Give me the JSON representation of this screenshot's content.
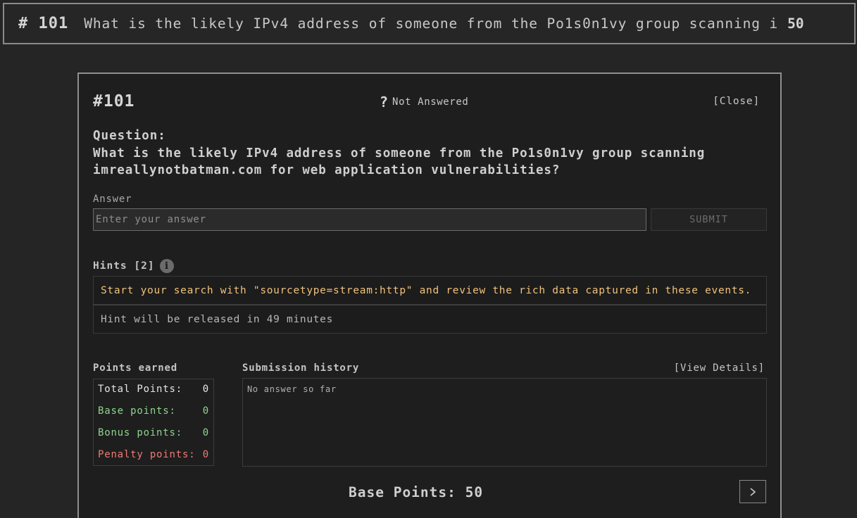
{
  "top_bar": {
    "number": "# 101",
    "question": "What is the likely IPv4 address of someone from the Po1s0n1vy group scanning i",
    "points": "50"
  },
  "modal": {
    "id": "#101",
    "status": "Not Answered",
    "close_label": "[Close]",
    "question_label": "Question:",
    "question_text": "What is the likely IPv4 address of someone from the Po1s0n1vy group scanning imreallynotbatman.com for web application vulnerabilities?",
    "answer_label": "Answer",
    "answer_placeholder": "Enter your answer",
    "submit_label": "SUBMIT",
    "hints_label": "Hints [2]",
    "hints": [
      "Start your search with \"sourcetype=stream:http\" and review the rich data captured in these events.",
      "Hint will be released in 49 minutes"
    ],
    "points_earned": {
      "label": "Points earned",
      "rows": [
        {
          "label": "Total Points:",
          "value": "0"
        },
        {
          "label": "Base points:",
          "value": "0"
        },
        {
          "label": "Bonus points:",
          "value": "0"
        },
        {
          "label": "Penalty points:",
          "value": "0"
        }
      ]
    },
    "submission_history": {
      "label": "Submission history",
      "view_details": "[View Details]",
      "empty_text": "No answer so far"
    },
    "base_points": "Base Points: 50"
  },
  "colors": {
    "hint_accent": "#f0c27b",
    "positive": "#8fd48f",
    "penalty": "#f07878"
  }
}
